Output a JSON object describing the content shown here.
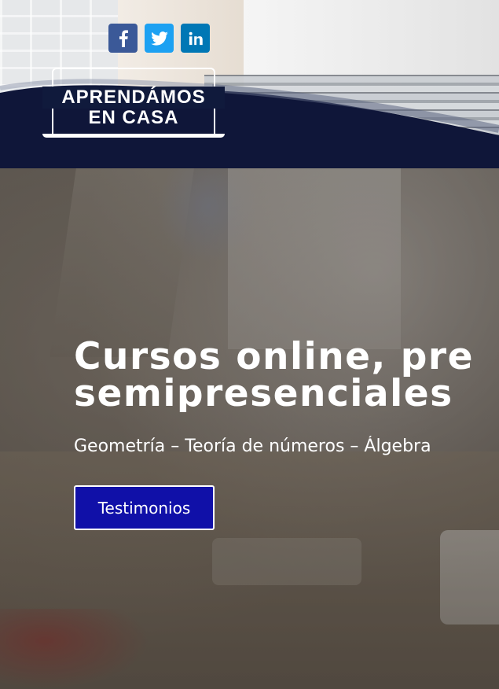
{
  "header": {
    "social": [
      {
        "name": "facebook",
        "glyph": "f",
        "color": "#3b5998"
      },
      {
        "name": "twitter",
        "glyph": "t",
        "color": "#1da1f2"
      },
      {
        "name": "linkedin",
        "glyph": "in",
        "color": "#0077b5"
      }
    ],
    "logo": {
      "line1": "APRENDÁMOS",
      "line2": "EN CASA"
    },
    "band_color": "#0f1639"
  },
  "hero": {
    "title_line1": "Cursos online, pre",
    "title_line2": "semipresenciales",
    "subtitle": "Geometría – Teoría de números – Álgebra",
    "cta_label": "Testimonios",
    "cta_color": "#1010a8"
  }
}
